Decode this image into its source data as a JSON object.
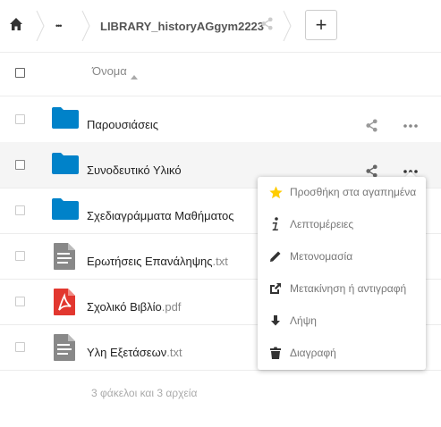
{
  "breadcrumb": {
    "folder_title": "LIBRARY_historyAGgym2223",
    "more_glyph": "•••",
    "add_glyph": "+"
  },
  "header": {
    "name_label": "Όνομα"
  },
  "files": [
    {
      "name": "Παρουσιάσεις",
      "ext": "",
      "icon": "folder-icon"
    },
    {
      "name": "Συνοδευτικό Υλικό",
      "ext": "",
      "icon": "folder-icon"
    },
    {
      "name": "Σχεδιαγράμματα Μαθήματος",
      "ext": "",
      "icon": "folder-icon"
    },
    {
      "name": "Ερωτήσεις Επανάληψης",
      "ext": ".txt",
      "icon": "text-file-icon"
    },
    {
      "name": "Σχολικό Βιβλίο",
      "ext": ".pdf",
      "icon": "pdf-file-icon"
    },
    {
      "name": "Υλη Εξετάσεων",
      "ext": ".txt",
      "icon": "text-file-icon"
    }
  ],
  "summary": "3 φάκελοι και 3 αρχεία",
  "context_menu": {
    "items": [
      {
        "label": "Προσθήκη στα αγαπημένα",
        "icon": "star-icon"
      },
      {
        "label": "Λεπτομέρειες",
        "icon": "info-icon"
      },
      {
        "label": "Μετονομασία",
        "icon": "pencil-icon"
      },
      {
        "label": "Μετακίνηση ή αντιγραφή",
        "icon": "external-move-icon"
      },
      {
        "label": "Λήψη",
        "icon": "download-icon"
      },
      {
        "label": "Διαγραφή",
        "icon": "trash-icon"
      }
    ]
  },
  "colors": {
    "folder": "#0082c9",
    "pdf": "#e2372f",
    "text_file": "#888888",
    "star": "#fc0"
  }
}
